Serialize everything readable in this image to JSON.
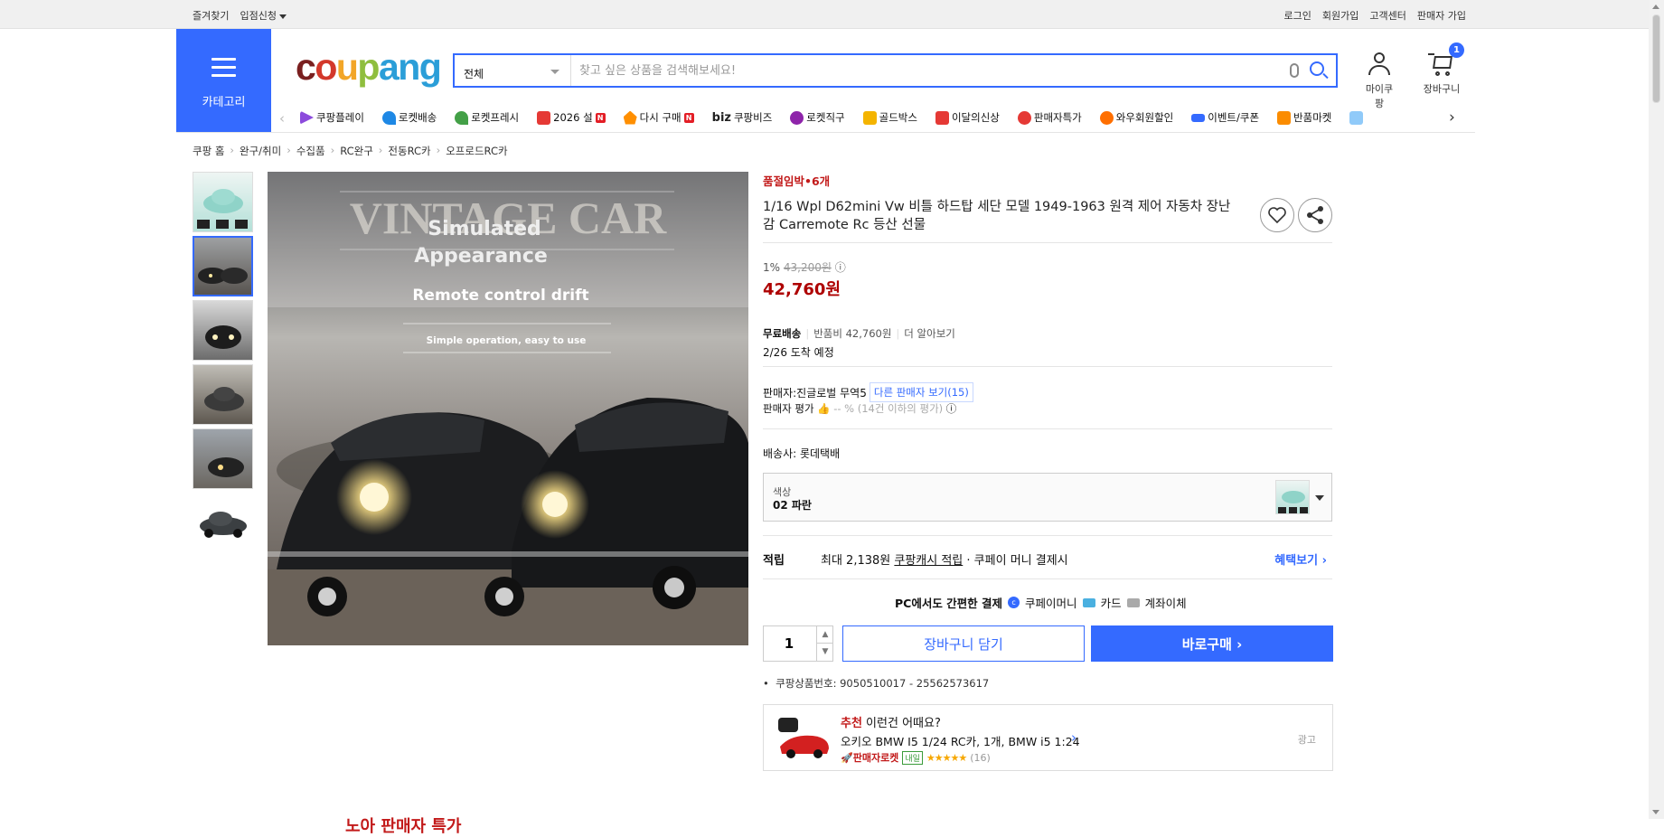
{
  "topbar": {
    "left": [
      "즐겨찾기",
      "입점신청"
    ],
    "right": [
      "로그인",
      "회원가입",
      "고객센터",
      "판매자 가입"
    ]
  },
  "header": {
    "category_label": "카테고리",
    "search_category": "전체",
    "search_placeholder": "찾고 싶은 상품을 검색해보세요!",
    "mypage_label": "마이쿠팡",
    "cart_label": "장바구니",
    "cart_count": "1",
    "logo_parts": [
      "c",
      "o",
      "u",
      "p",
      "ang"
    ]
  },
  "nav": {
    "items": [
      "쿠팡플레이",
      "로켓배송",
      "로켓프레시",
      "2026 설",
      "다시 구매",
      "쿠팡비즈",
      "로켓직구",
      "골드박스",
      "이달의신상",
      "판매자특가",
      "와우회원할인",
      "이벤트/쿠폰",
      "반품마켓"
    ],
    "biz_prefix": "biz",
    "new_badge": "N",
    "colors": [
      "#8c4bdc",
      "#1e88e5",
      "#43a047",
      "#e53935",
      "#ff8f00",
      "#222222",
      "#8e24aa",
      "#f4b400",
      "#e53935",
      "#e53935",
      "#ff6f00",
      "#346aff",
      "#fb8c00"
    ]
  },
  "breadcrumb": [
    "쿠팡 홈",
    "완구/취미",
    "수집품",
    "RC완구",
    "전동RC카",
    "오프로드RC카"
  ],
  "image_text": {
    "overlay_big": "VINTAGE CAR",
    "line1": "Simulated",
    "line2": "Appearance",
    "line3": "Remote control drift",
    "line4": "Simple operation, easy to use"
  },
  "product": {
    "stock_warning": "품절임박•6개",
    "title": "1/16 Wpl D62mini Vw 비틀 하드탑 세단 모델 1949-1963 원격 제어 자동차 장난감 Carremote Rc 등산 선물",
    "discount_rate": "1%",
    "original_price": "43,200원",
    "price": "42,760원",
    "shipping_label": "무료배송",
    "return_fee": "반품비 42,760원",
    "learn_more": "더 알아보기",
    "arrival": "2/26 도착 예정",
    "seller_prefix": "판매자:",
    "seller_name": "진글로벌 무역5",
    "other_sellers": "다른 판매자 보기(15)",
    "seller_rating_label": "판매자 평가",
    "seller_rating_value": "-- % (14건 이하의 평가)",
    "courier": "배송사:  롯데택배",
    "option_key": "색상",
    "option_value": "02 파란",
    "reward_label": "적립",
    "reward_text1": "최대 2,138원",
    "reward_link": "쿠팡캐시 적립",
    "reward_text2": "· 쿠페이 머니 결제시",
    "benefit_link": "혜택보기 ›",
    "pay_title": "PC에서도 간편한 결제",
    "pay_methods": [
      "쿠페이머니",
      "카드",
      "계좌이체"
    ],
    "quantity": "1",
    "cart_button": "장바구니 담기",
    "buy_button": "바로구매 ›",
    "product_id": "쿠팡상품번호: 9050510017 - 25562573617"
  },
  "recommend": {
    "tag": "추천",
    "title": " 이런건 어때요?",
    "name": "오키오 BMW I5 1/24 RC카, 1개, BMW i5 1:24",
    "rocket": "판매자로켓",
    "tomorrow": "내일",
    "stars": "★★★★★",
    "count": "(16)",
    "ad_label": "광고"
  },
  "below": "노아 판매자 특가"
}
